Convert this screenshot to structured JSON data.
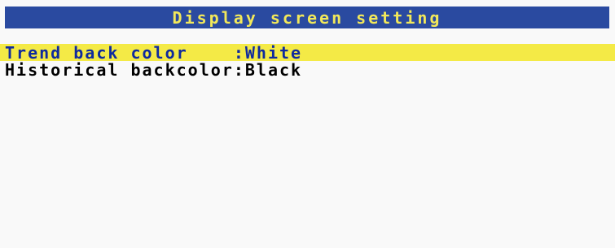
{
  "header": {
    "title": "Display screen setting"
  },
  "settings": [
    {
      "label": "Trend back color    ",
      "separator": ":",
      "value": "White",
      "selected": true
    },
    {
      "label": "Historical backcolor",
      "separator": ":",
      "value": "Black",
      "selected": false
    }
  ],
  "colors": {
    "title_bar_bg": "#2a4aa0",
    "title_text": "#f2e85a",
    "highlight_bg": "#f4ea46",
    "highlight_text": "#0f2a9e",
    "normal_text": "#000000",
    "screen_bg": "#f9f9f9"
  }
}
